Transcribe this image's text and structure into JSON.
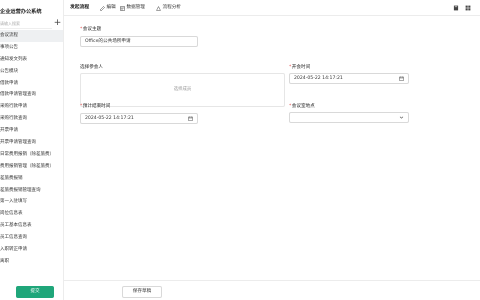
{
  "sidebar": {
    "app_title": "企业运营办公系统",
    "search_placeholder": "请输入搜索",
    "add_symbol": "+",
    "items": [
      {
        "label": "会议流程"
      },
      {
        "label": "事项公告"
      },
      {
        "label": "通知发文列表"
      },
      {
        "label": "公告模块"
      },
      {
        "label": "借款申请"
      },
      {
        "label": "借款申请管理查询"
      },
      {
        "label": "采购行款申请"
      },
      {
        "label": "采购行款查询"
      },
      {
        "label": "开票申请"
      },
      {
        "label": "开票申请管理查询"
      },
      {
        "label": "日常费用报销（除差旅费）"
      },
      {
        "label": "费用报销管理（除差旅费）"
      },
      {
        "label": "差旅费报销"
      },
      {
        "label": "差旅费报销管理查询"
      },
      {
        "label": "第一入驻填写"
      },
      {
        "label": "岗位信息表"
      },
      {
        "label": "员工基本信息表"
      },
      {
        "label": "员工信息查询"
      },
      {
        "label": "入职转正申请"
      },
      {
        "label": "离职"
      }
    ]
  },
  "toolbar": {
    "title": "发起流程",
    "buttons": [
      {
        "label": "编辑",
        "icon": "edit-icon"
      },
      {
        "label": "数据管理",
        "icon": "table-icon"
      },
      {
        "label": "流程分析",
        "icon": "chart-icon"
      }
    ],
    "right_icons": [
      "book-icon",
      "grid-icon"
    ]
  },
  "form": {
    "topic_label": "会议主题",
    "topic_value": "Office的公共场所申请",
    "attendees_label": "选择参会人",
    "attendees_hint": "选择成员",
    "start_label": "开会时间",
    "start_value": "2024-05-22 14:17:21",
    "end_label": "预计结束时间",
    "end_value": "2024-05-22 14:17:21",
    "location_label": "会议室地点",
    "location_value": ""
  },
  "footer": {
    "submit_label": "提交",
    "save_draft_label": "保存草稿"
  },
  "colors": {
    "primary": "#1fa67a",
    "required": "#e34d4d"
  }
}
